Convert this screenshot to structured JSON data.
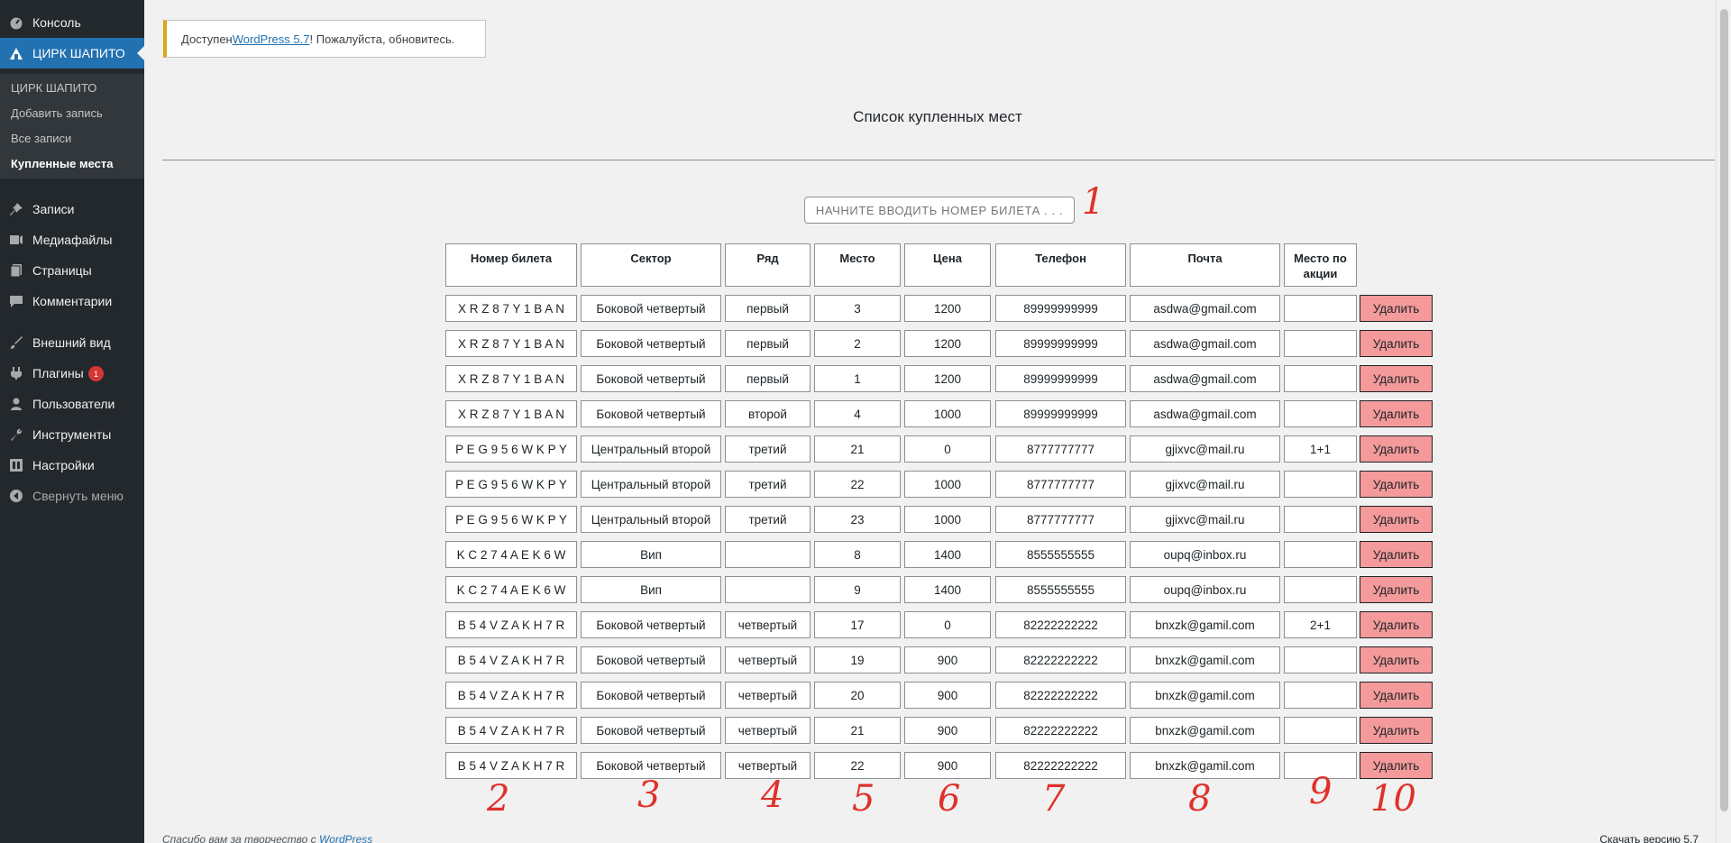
{
  "sidebar": {
    "items": [
      {
        "label": "Консоль",
        "icon": "dashboard-icon"
      },
      {
        "label": "ЦИРК ШАПИТО",
        "icon": "circus-icon"
      },
      {
        "label": "Записи",
        "icon": "pin-icon"
      },
      {
        "label": "Медиафайлы",
        "icon": "media-icon"
      },
      {
        "label": "Страницы",
        "icon": "pages-icon"
      },
      {
        "label": "Комментарии",
        "icon": "comments-icon"
      },
      {
        "label": "Внешний вид",
        "icon": "brush-icon"
      },
      {
        "label": "Плагины",
        "icon": "plugins-icon",
        "badge": "1"
      },
      {
        "label": "Пользователи",
        "icon": "users-icon"
      },
      {
        "label": "Инструменты",
        "icon": "tools-icon"
      },
      {
        "label": "Настройки",
        "icon": "settings-icon"
      },
      {
        "label": "Свернуть меню",
        "icon": "collapse-icon"
      }
    ],
    "submenu": [
      "ЦИРК ШАПИТО",
      "Добавить запись",
      "Все записи",
      "Купленные места"
    ]
  },
  "notice": {
    "prefix": "Доступен ",
    "link": "WordPress 5.7",
    "suffix": "! Пожалуйста, обновитесь."
  },
  "page_title": "Список купленных мест",
  "search": {
    "placeholder": "НАЧНИТЕ ВВОДИТЬ НОМЕР БИЛЕТА . . ."
  },
  "table": {
    "headers": [
      "Номер билета",
      "Сектор",
      "Ряд",
      "Место",
      "Цена",
      "Телефон",
      "Почта",
      "Место по акции"
    ],
    "delete_label": "Удалить",
    "rows": [
      [
        "X R Z 8 7 Y 1 B A N",
        "Боковой четвертый",
        "первый",
        "3",
        "1200",
        "89999999999",
        "asdwa@gmail.com",
        ""
      ],
      [
        "X R Z 8 7 Y 1 B A N",
        "Боковой четвертый",
        "первый",
        "2",
        "1200",
        "89999999999",
        "asdwa@gmail.com",
        ""
      ],
      [
        "X R Z 8 7 Y 1 B A N",
        "Боковой четвертый",
        "первый",
        "1",
        "1200",
        "89999999999",
        "asdwa@gmail.com",
        ""
      ],
      [
        "X R Z 8 7 Y 1 B A N",
        "Боковой четвертый",
        "второй",
        "4",
        "1000",
        "89999999999",
        "asdwa@gmail.com",
        ""
      ],
      [
        "P E G 9 5 6 W K P Y",
        "Центральный второй",
        "третий",
        "21",
        "0",
        "8777777777",
        "gjixvc@mail.ru",
        "1+1"
      ],
      [
        "P E G 9 5 6 W K P Y",
        "Центральный второй",
        "третий",
        "22",
        "1000",
        "8777777777",
        "gjixvc@mail.ru",
        ""
      ],
      [
        "P E G 9 5 6 W K P Y",
        "Центральный второй",
        "третий",
        "23",
        "1000",
        "8777777777",
        "gjixvc@mail.ru",
        ""
      ],
      [
        "K C 2 7 4 A E K 6 W",
        "Вип",
        "",
        "8",
        "1400",
        "8555555555",
        "oupq@inbox.ru",
        ""
      ],
      [
        "K C 2 7 4 A E K 6 W",
        "Вип",
        "",
        "9",
        "1400",
        "8555555555",
        "oupq@inbox.ru",
        ""
      ],
      [
        "B 5 4 V Z A K H 7 R",
        "Боковой четвертый",
        "четвертый",
        "17",
        "0",
        "82222222222",
        "bnxzk@gamil.com",
        "2+1"
      ],
      [
        "B 5 4 V Z A K H 7 R",
        "Боковой четвертый",
        "четвертый",
        "19",
        "900",
        "82222222222",
        "bnxzk@gamil.com",
        ""
      ],
      [
        "B 5 4 V Z A K H 7 R",
        "Боковой четвертый",
        "четвертый",
        "20",
        "900",
        "82222222222",
        "bnxzk@gamil.com",
        ""
      ],
      [
        "B 5 4 V Z A K H 7 R",
        "Боковой четвертый",
        "четвертый",
        "21",
        "900",
        "82222222222",
        "bnxzk@gamil.com",
        ""
      ],
      [
        "B 5 4 V Z A K H 7 R",
        "Боковой четвертый",
        "четвертый",
        "22",
        "900",
        "82222222222",
        "bnxzk@gamil.com",
        ""
      ]
    ]
  },
  "annotations": [
    "1",
    "2",
    "3",
    "4",
    "5",
    "6",
    "7",
    "8",
    "9",
    "10"
  ],
  "footer": {
    "left_text": "Спасибо вам за творчество с ",
    "left_link": "WordPress",
    "right": "Скачать версию 5.7"
  },
  "colors": {
    "accent": "#2271b1",
    "delete": "#f49a9a",
    "annotation": "#e0312b",
    "notice": "#dba617"
  }
}
